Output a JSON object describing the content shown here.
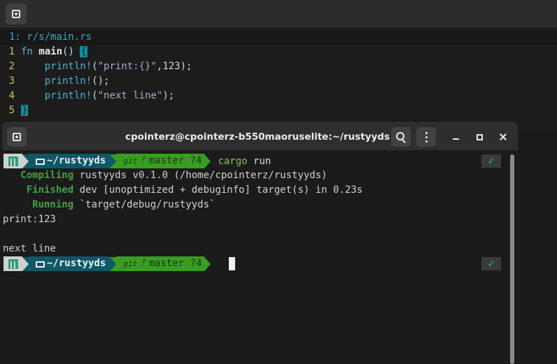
{
  "editor": {
    "file_label": "1: r/s/main.rs",
    "lines": [
      {
        "num": "1",
        "keyword": "fn",
        "name": "main",
        "parens": "()",
        "brace": "{"
      },
      {
        "num": "2",
        "macro": "println!",
        "open": "(",
        "string": "\"print:{}\"",
        "comma": ",",
        "arg": "123",
        "close": ");"
      },
      {
        "num": "3",
        "macro": "println!",
        "rest": "();"
      },
      {
        "num": "4",
        "macro": "println!",
        "open": "(",
        "string": "\"next line\"",
        "close": ");"
      },
      {
        "num": "5",
        "brace": "}"
      }
    ]
  },
  "terminal": {
    "title": "cpointerz@cpointerz-b550maoruselite:~/rustyyds",
    "prompt": {
      "dir": "~/rustyyds",
      "git_word": "git",
      "branch_glyph": "ᚠ",
      "branch": "master ?4",
      "ok": "✓"
    },
    "command_word": "cargo",
    "command_arg": "run",
    "output": [
      {
        "tag": "   Compiling",
        "text": " rustyyds v0.1.0 (/home/cpointerz/rustyyds)"
      },
      {
        "tag": "    Finished",
        "text": " dev [unoptimized + debuginfo] target(s) in 0.23s"
      },
      {
        "tag": "     Running",
        "text": " `target/debug/rustyyds`"
      },
      {
        "tag": "",
        "text": "print:123"
      },
      {
        "tag": "",
        "text": ""
      },
      {
        "tag": "",
        "text": "next line"
      }
    ]
  },
  "icons": {
    "new_tab": "new-tab-icon",
    "search": "search-icon",
    "menu": "menu-icon",
    "minimize": "minimize-icon",
    "maximize": "maximize-icon",
    "close": "close-icon"
  },
  "colors": {
    "prompt_dir_bg": "#0f5867",
    "prompt_git_bg": "#3a9d23",
    "cargo_tag": "#43a047",
    "line_number": "#d7c04a",
    "brace_highlight": "#0f8e9a"
  }
}
